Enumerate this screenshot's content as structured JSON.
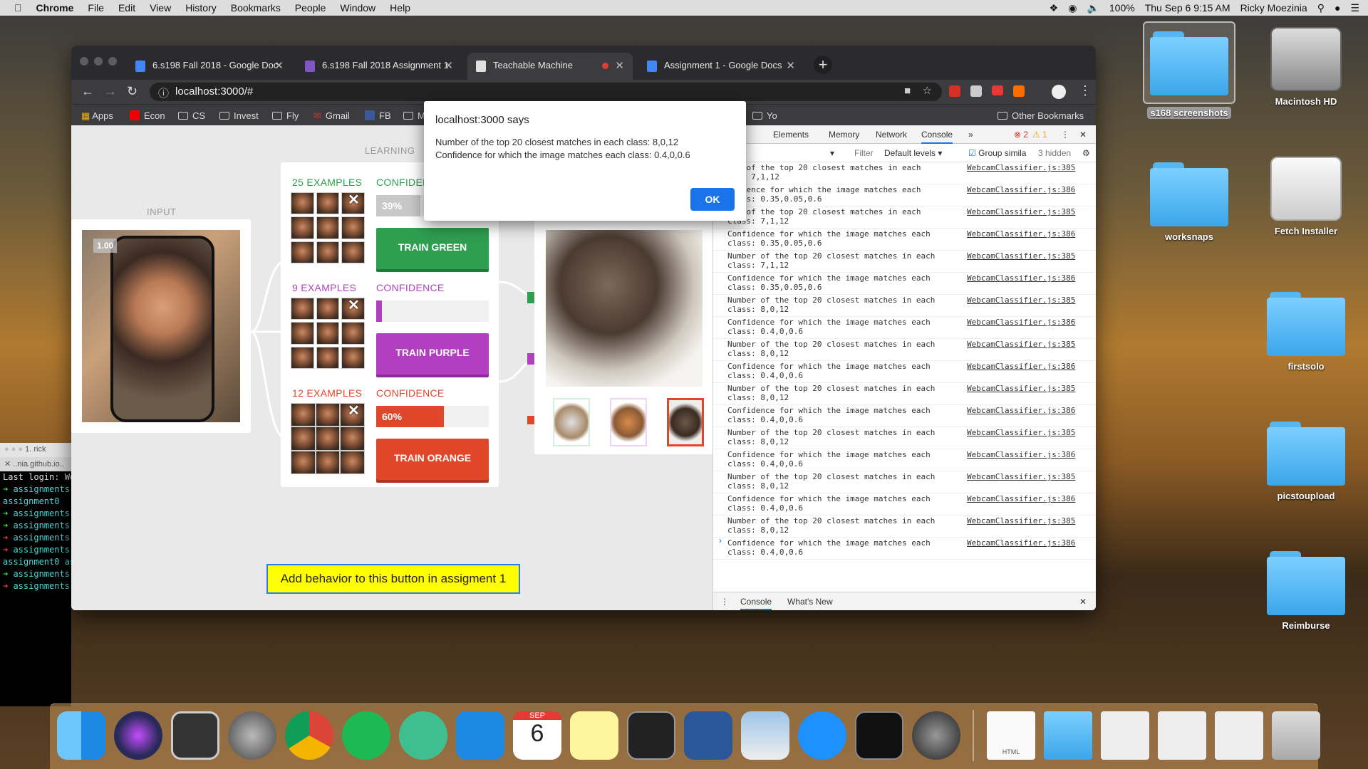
{
  "menubar": {
    "app": "Chrome",
    "items": [
      "File",
      "Edit",
      "View",
      "History",
      "Bookmarks",
      "People",
      "Window",
      "Help"
    ],
    "battery": "100%",
    "datetime": "Thu Sep 6  9:15 AM",
    "user": "Ricky Moezinia"
  },
  "desktop": {
    "icons": [
      {
        "label": "s168 screenshots"
      },
      {
        "label": "Macintosh HD"
      },
      {
        "label": "worksnaps"
      },
      {
        "label": "Fetch Installer"
      },
      {
        "label": "firstsolo"
      },
      {
        "label": "picstoupload"
      },
      {
        "label": "Reimburse"
      }
    ]
  },
  "terminal": {
    "title": "1. rick",
    "tab": "..nia.github.io..",
    "lines": [
      "Last login: We",
      "assignments",
      "assignment0",
      "assignments",
      "assignments",
      "assignments",
      "assignments",
      "assignment0 as",
      "assignments",
      "assignments"
    ]
  },
  "browser": {
    "tabs": [
      {
        "title": "6.s198 Fall 2018 - Google Doc"
      },
      {
        "title": "6.s198 Fall 2018 Assignment 1"
      },
      {
        "title": "Teachable Machine"
      },
      {
        "title": "Assignment 1 - Google Docs"
      }
    ],
    "url": "localhost:3000/#",
    "bookmarks": [
      "Apps",
      "Econ",
      "CS",
      "Invest",
      "Fly",
      "Gmail",
      "FB",
      "M",
      "Yo",
      "Other Bookmarks"
    ]
  },
  "app": {
    "learning_label": "LEARNING",
    "input_label": "INPUT",
    "input_badge": "1.00",
    "classes": [
      {
        "examples": "25 EXAMPLES",
        "confidence_label": "CONFIDEN",
        "confidence_value": "39%",
        "confidence": 0.39,
        "button": "TRAIN GREEN",
        "color": "#2e9e4f"
      },
      {
        "examples": "9 EXAMPLES",
        "confidence_label": "CONFIDENCE",
        "confidence_value": "",
        "confidence": 0,
        "button": "TRAIN PURPLE",
        "color": "#b23fc0"
      },
      {
        "examples": "12 EXAMPLES",
        "confidence_label": "CONFIDENCE",
        "confidence_value": "60%",
        "confidence": 0.6,
        "button": "TRAIN ORANGE",
        "color": "#e0462a"
      }
    ],
    "add_button": "Add behavior to this button in assigment 1"
  },
  "dialog": {
    "title": "localhost:3000 says",
    "line1": "Number of the top 20 closest matches in each class: 8,0,12",
    "line2": "Confidence for which the image matches each class: 0.4,0,0.6",
    "ok": "OK"
  },
  "devtools": {
    "tabs": [
      "Elements",
      "Memory",
      "Network",
      "Console"
    ],
    "errors": "2",
    "warnings": "1",
    "context": "top",
    "filter": "Filter",
    "levels": "Default levels",
    "group": "Group simila",
    "hidden": "3 hidden",
    "drawer_tabs": [
      "Console",
      "What's New"
    ],
    "logs": [
      {
        "msg": "ber of the top 20 closest matches in each\nass: 7,1,12",
        "src": "WebcamClassifier.js:385"
      },
      {
        "msg": "nfidence for which the image matches each\nclass: 0.35,0.05,0.6",
        "src": "WebcamClassifier.js:386"
      },
      {
        "msg": "ber of the top 20 closest matches in each\nclass: 7,1,12",
        "src": "WebcamClassifier.js:385"
      },
      {
        "msg": "Confidence for which the image matches each\nclass: 0.35,0.05,0.6",
        "src": "WebcamClassifier.js:386"
      },
      {
        "msg": "Number of the top 20 closest matches in each\nclass: 7,1,12",
        "src": "WebcamClassifier.js:385"
      },
      {
        "msg": "Confidence for which the image matches each\nclass: 0.35,0.05,0.6",
        "src": "WebcamClassifier.js:386"
      },
      {
        "msg": "Number of the top 20 closest matches in each\nclass: 8,0,12",
        "src": "WebcamClassifier.js:385"
      },
      {
        "msg": "Confidence for which the image matches each\nclass: 0.4,0,0.6",
        "src": "WebcamClassifier.js:386"
      },
      {
        "msg": "Number of the top 20 closest matches in each\nclass: 8,0,12",
        "src": "WebcamClassifier.js:385"
      },
      {
        "msg": "Confidence for which the image matches each\nclass: 0.4,0,0.6",
        "src": "WebcamClassifier.js:386"
      },
      {
        "msg": "Number of the top 20 closest matches in each\nclass: 8,0,12",
        "src": "WebcamClassifier.js:385"
      },
      {
        "msg": "Confidence for which the image matches each\nclass: 0.4,0,0.6",
        "src": "WebcamClassifier.js:386"
      },
      {
        "msg": "Number of the top 20 closest matches in each\nclass: 8,0,12",
        "src": "WebcamClassifier.js:385"
      },
      {
        "msg": "Confidence for which the image matches each\nclass: 0.4,0,0.6",
        "src": "WebcamClassifier.js:386"
      },
      {
        "msg": "Number of the top 20 closest matches in each\nclass: 8,0,12",
        "src": "WebcamClassifier.js:385"
      },
      {
        "msg": "Confidence for which the image matches each\nclass: 0.4,0,0.6",
        "src": "WebcamClassifier.js:386"
      },
      {
        "msg": "Number of the top 20 closest matches in each\nclass: 8,0,12",
        "src": "WebcamClassifier.js:385"
      },
      {
        "msg": "Confidence for which the image matches each\nclass: 0.4,0,0.6",
        "src": "WebcamClassifier.js:386"
      }
    ]
  },
  "dock": {
    "calendar_month": "SEP",
    "calendar_day": "6",
    "file_label": "HTML"
  }
}
